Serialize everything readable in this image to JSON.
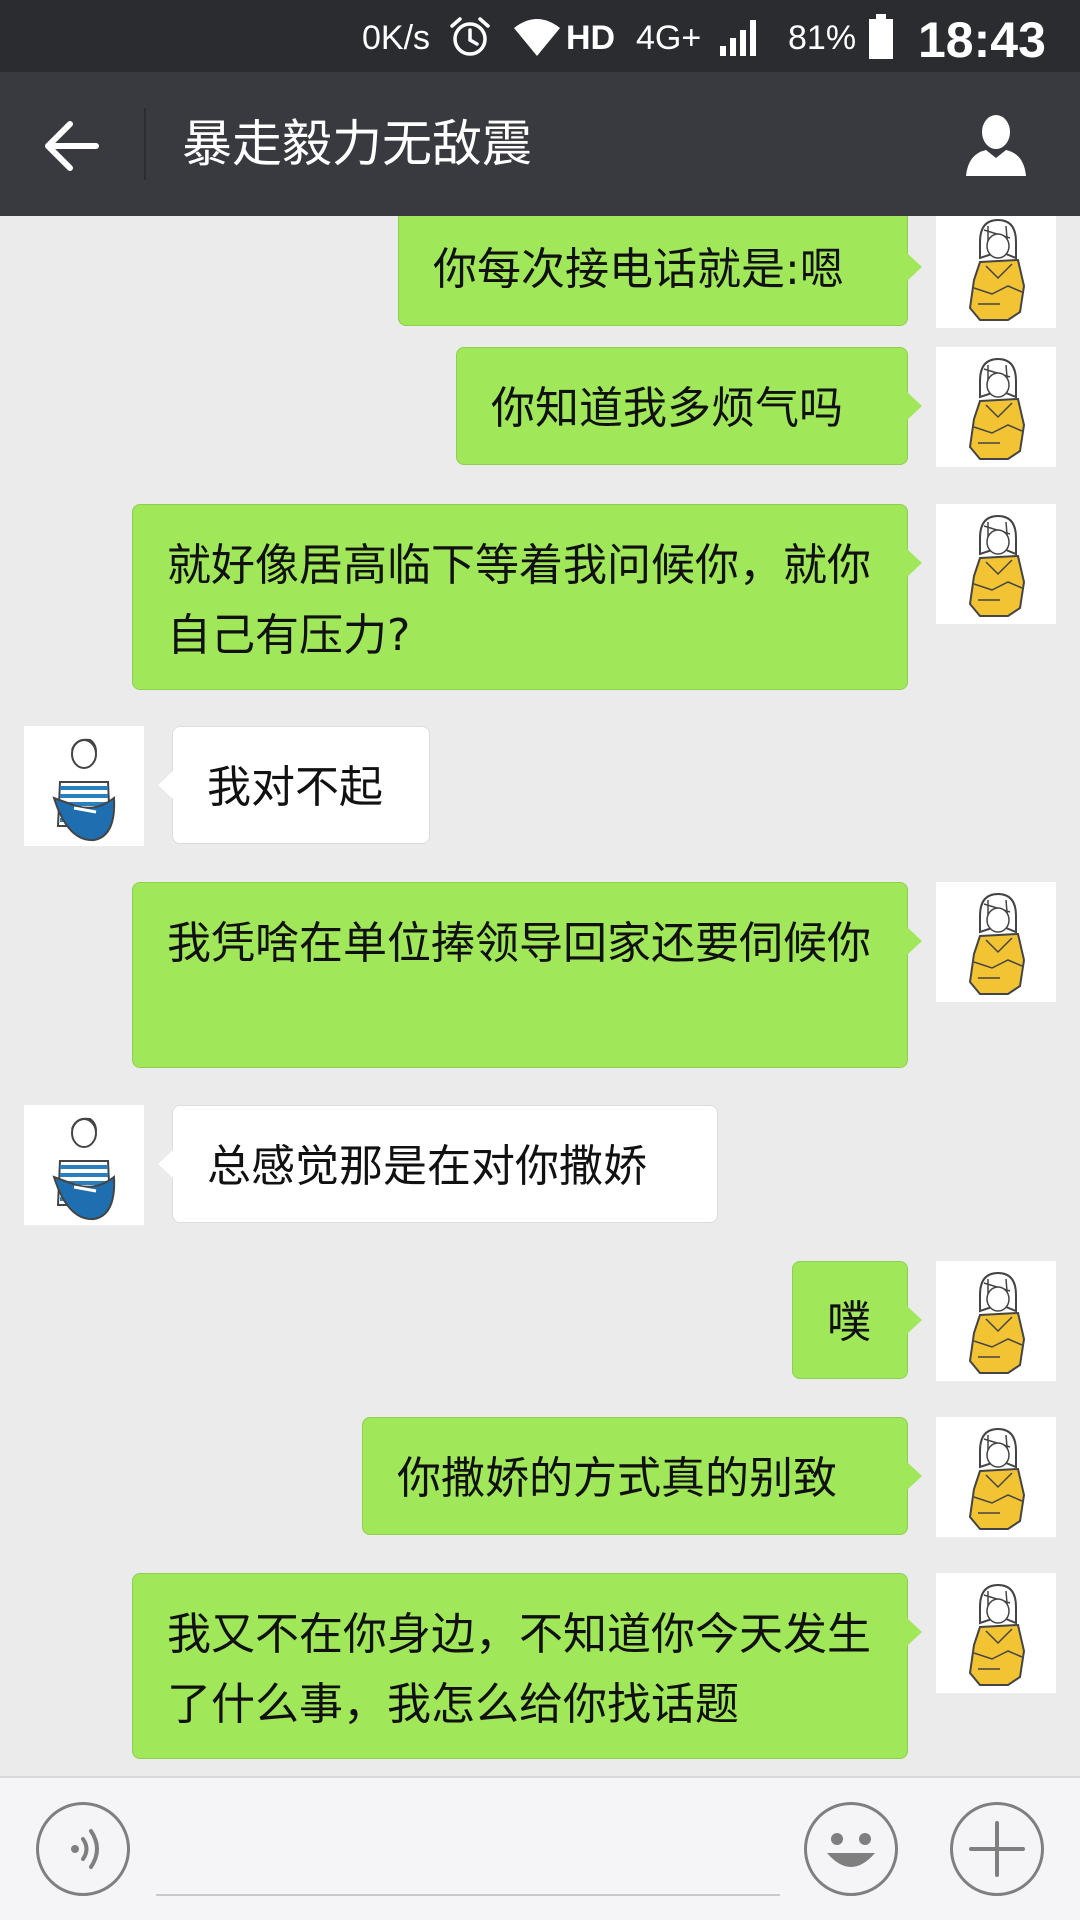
{
  "status_bar": {
    "speed": "0K/s",
    "hd": "HD",
    "network": "4G+",
    "battery": "81%",
    "time": "18:43",
    "icons": [
      "alarm-icon",
      "wifi-icon",
      "signal-icon",
      "battery-icon"
    ]
  },
  "header": {
    "title": "暴走毅力无敌震",
    "back_icon": "arrow-left-icon",
    "profile_icon": "person-icon"
  },
  "messages": [
    {
      "side": "right",
      "text": "你每次接电话就是:嗯"
    },
    {
      "side": "right",
      "text": "你知道我多烦气吗"
    },
    {
      "side": "right",
      "text": "就好像居高临下等着我问候你，就你自己有压力?"
    },
    {
      "side": "left",
      "text": "我对不起"
    },
    {
      "side": "right",
      "text": "我凭啥在单位捧领导回家还要伺候你"
    },
    {
      "side": "left",
      "text": "总感觉那是在对你撒娇"
    },
    {
      "side": "right",
      "text": "噗"
    },
    {
      "side": "right",
      "text": "你撒娇的方式真的别致"
    },
    {
      "side": "right",
      "text": "我又不在你身边，不知道你今天发生了什么事，我怎么给你找话题"
    }
  ],
  "input_bar": {
    "voice_icon": "voice-icon",
    "emoji_icon": "emoji-icon",
    "plus_icon": "plus-icon",
    "placeholder": ""
  },
  "colors": {
    "outgoing_bubble": "#a0e75a",
    "incoming_bubble": "#ffffff",
    "chat_background": "#ebebeb",
    "title_bar": "#393a3f",
    "status_bar": "#2b2c30"
  }
}
